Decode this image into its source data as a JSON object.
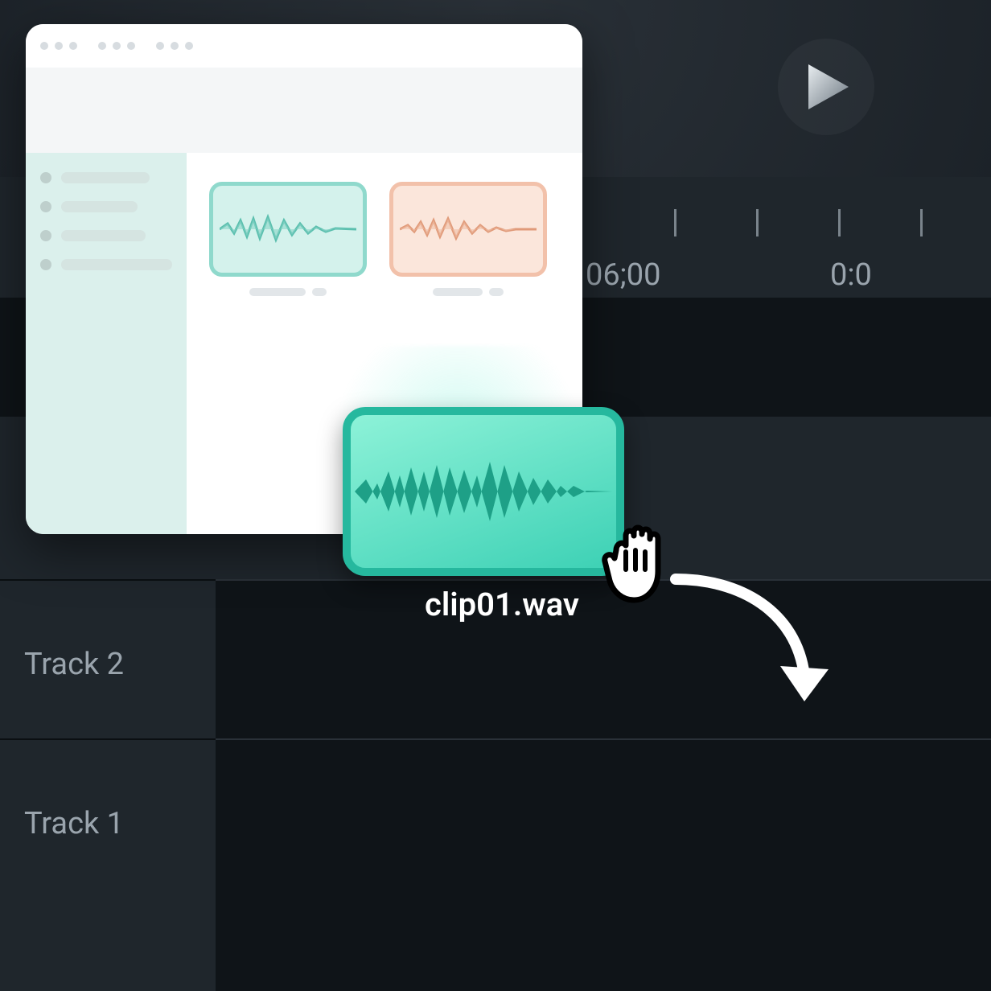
{
  "playback": {
    "play_label": "Play"
  },
  "timeline": {
    "timecodes": [
      "06;00",
      "0:0"
    ]
  },
  "tracks": {
    "track2": {
      "label": "Track 2"
    },
    "track1": {
      "label": "Track 1"
    }
  },
  "file_browser": {
    "clips": [
      {
        "color": "teal"
      },
      {
        "color": "orange"
      }
    ]
  },
  "drag": {
    "clip_name": "clip01.wav"
  },
  "colors": {
    "teal": "#3dd1b5",
    "teal_border": "#26b89e",
    "orange": "#f2c1aa",
    "bg_dark": "#12171b",
    "panel": "#1f262c",
    "text_muted": "#9aa4ad"
  }
}
